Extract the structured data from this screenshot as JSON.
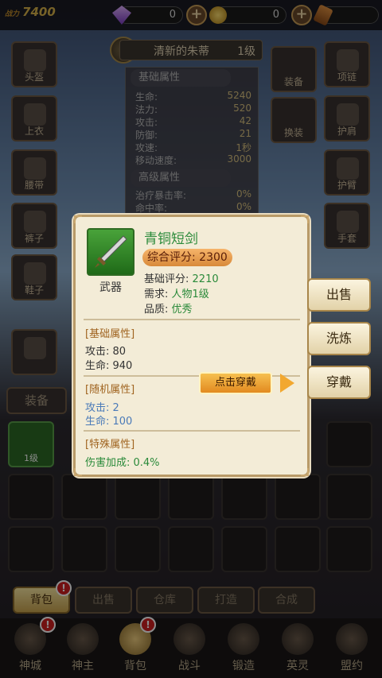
{
  "top": {
    "power_label": "战力",
    "power_value": "7400",
    "diamonds": "0",
    "gold": "0"
  },
  "equip_slots": {
    "left": [
      "头盔",
      "上衣",
      "腰带",
      "裤子",
      "鞋子"
    ],
    "right": [
      "项链",
      "护肩",
      "护臂",
      "手套"
    ],
    "right_actions": [
      "装备",
      "换装"
    ]
  },
  "item_panel": {
    "name": "清新的朱蒂",
    "level": "1级",
    "basic_header": "基础属性",
    "basic_stats": [
      {
        "label": "生命:",
        "value": "5240"
      },
      {
        "label": "法力:",
        "value": "520"
      },
      {
        "label": "攻击:",
        "value": "42"
      },
      {
        "label": "防御:",
        "value": "21"
      },
      {
        "label": "攻速:",
        "value": "1秒"
      },
      {
        "label": "移动速度:",
        "value": "3000"
      }
    ],
    "adv_header": "高级属性",
    "adv_stats": [
      {
        "label": "治疗暴击率:",
        "value": "0%"
      },
      {
        "label": "命中率:",
        "value": "0%"
      }
    ]
  },
  "tabs": {
    "equip": "装备"
  },
  "inventory": {
    "first_item_level": "1级"
  },
  "bottom_buttons": [
    "背包",
    "出售",
    "仓库",
    "打造",
    "合成"
  ],
  "nav": [
    "神城",
    "神主",
    "背包",
    "战斗",
    "锻造",
    "英灵",
    "盟约"
  ],
  "popup": {
    "item_name": "青铜短剑",
    "item_type": "武器",
    "score": "综合评分: 2300",
    "base_score_label": "基础评分:",
    "base_score_value": "2210",
    "requirement_label": "需求:",
    "requirement_value": "人物1级",
    "quality_label": "品质:",
    "quality_value": "优秀",
    "base_section": "[基础属性]",
    "base_lines": [
      "攻击: 80",
      "生命: 940"
    ],
    "random_section": "[随机属性]",
    "random_lines": [
      "攻击: 2",
      "生命: 100"
    ],
    "special_section": "[特殊属性]",
    "special_lines": [
      "伤害加成: 0.4%"
    ],
    "tip": "点击穿戴"
  },
  "actions": {
    "sell": "出售",
    "refine": "洗炼",
    "wear": "穿戴"
  },
  "badge": "!"
}
